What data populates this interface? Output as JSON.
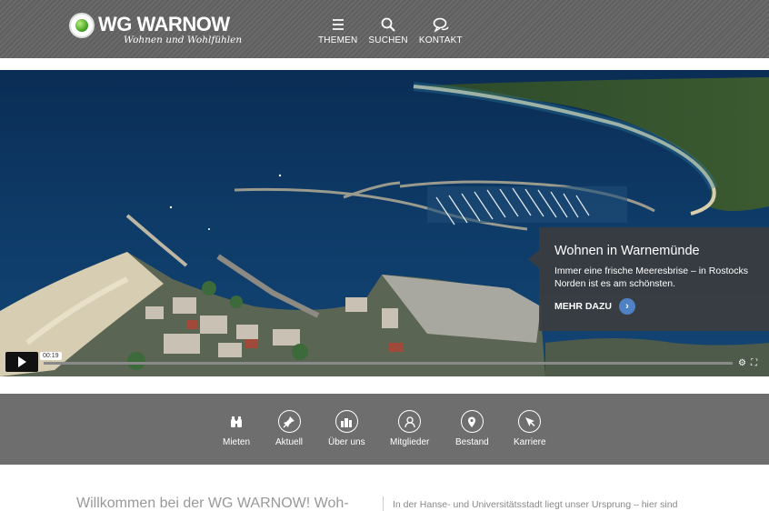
{
  "header": {
    "logo_text": "WG WARNOW",
    "logo_tagline": "Wohnen und Wohlfühlen",
    "nav": [
      {
        "label": "THEMEN",
        "icon": "menu-icon"
      },
      {
        "label": "SUCHEN",
        "icon": "search-icon"
      },
      {
        "label": "KONTAKT",
        "icon": "chat-icon"
      }
    ]
  },
  "video": {
    "time": "00:19",
    "overlay_title": "Wohnen in Warnemünde",
    "overlay_text": "Immer eine frische Meeresbrise – in Rostocks Norden ist es am schönsten.",
    "overlay_link": "MEHR DAZU"
  },
  "iconbar": [
    {
      "label": "Mieten",
      "icon": "binoculars-icon"
    },
    {
      "label": "Aktuell",
      "icon": "pin-icon"
    },
    {
      "label": "Über uns",
      "icon": "buildings-icon"
    },
    {
      "label": "Mitglieder",
      "icon": "people-icon"
    },
    {
      "label": "Bestand",
      "icon": "map-marker-icon"
    },
    {
      "label": "Karriere",
      "icon": "cursor-icon"
    }
  ],
  "content": {
    "welcome": "Willkommen bei der WG WARNOW! Woh-",
    "intro": "In der Hanse- und Universitätsstadt liegt unser Ursprung – hier sind"
  },
  "colors": {
    "header_bg": "#636363",
    "iconbar_bg": "#6e6e6e",
    "accent_blue": "#4f81c4",
    "logo_green": "#3c9a1e"
  }
}
